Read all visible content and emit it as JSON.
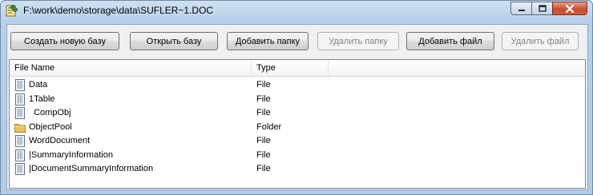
{
  "window": {
    "title": "F:\\work\\demo\\storage\\data\\SUFLER~1.DOC"
  },
  "toolbar": {
    "buttons": [
      {
        "label": "Создать новую базу",
        "enabled": true
      },
      {
        "label": "Открыть базу",
        "enabled": true
      },
      {
        "label": "Добавить папку",
        "enabled": true
      },
      {
        "label": "Удалить папку",
        "enabled": false
      },
      {
        "label": "Добавить файл",
        "enabled": true
      },
      {
        "label": "Удалить файл",
        "enabled": false
      }
    ]
  },
  "list": {
    "columns": [
      "File Name",
      "Type"
    ],
    "rows": [
      {
        "name": "Data",
        "type": "File",
        "icon": "document-icon"
      },
      {
        "name": "1Table",
        "type": "File",
        "icon": "document-icon"
      },
      {
        "name": "\u0001CompObj",
        "display": "  CompObj",
        "type": "File",
        "icon": "document-icon"
      },
      {
        "name": "ObjectPool",
        "type": "Folder",
        "icon": "folder-icon"
      },
      {
        "name": "WordDocument",
        "type": "File",
        "icon": "document-icon"
      },
      {
        "name": "|SummaryInformation",
        "type": "File",
        "icon": "document-icon"
      },
      {
        "name": "|DocumentSummaryInformation",
        "type": "File",
        "icon": "document-icon"
      }
    ]
  }
}
